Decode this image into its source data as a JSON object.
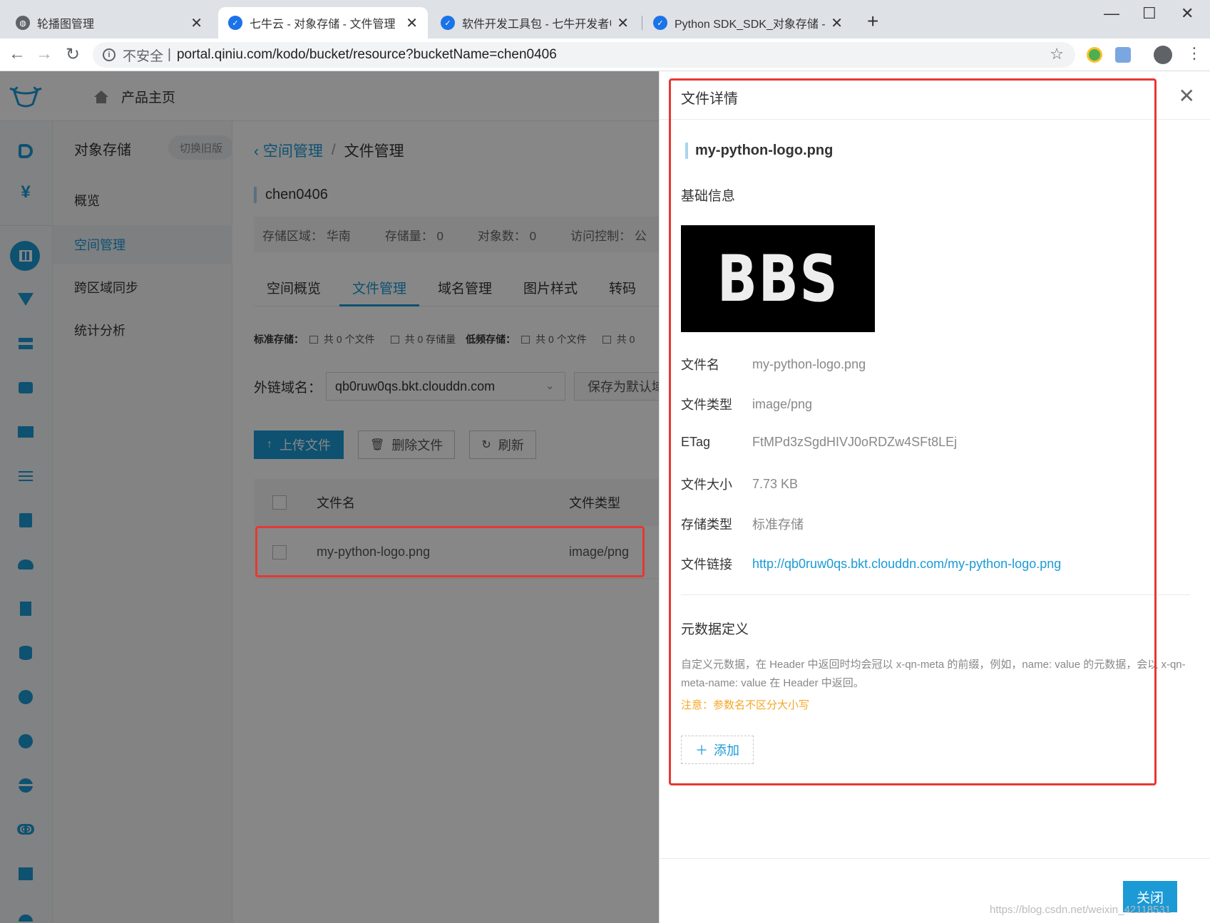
{
  "browser": {
    "tabs": [
      {
        "title": "轮播图管理",
        "close": "✕"
      },
      {
        "title": "七牛云 - 对象存储 - 文件管理",
        "close": "✕"
      },
      {
        "title": "软件开发工具包 - 七牛开发者中心",
        "close": "✕"
      },
      {
        "title": "Python SDK_SDK_对象存储 - 七牛",
        "close": "✕"
      }
    ],
    "new_tab": "+",
    "insecure_label": "不安全",
    "url": "portal.qiniu.com/kodo/bucket/resource?bucketName=chen0406"
  },
  "header": {
    "home_label": "产品主页"
  },
  "submenu": {
    "title": "对象存储",
    "old_version": "切换旧版",
    "items": [
      "概览",
      "空间管理",
      "跨区域同步",
      "统计分析"
    ]
  },
  "main": {
    "breadcrumb_back": "空间管理",
    "breadcrumb_sep": "/",
    "breadcrumb_current": "文件管理",
    "bucket": "chen0406",
    "stats": [
      "存储区域： 华南",
      "存储量： 0",
      "对象数： 0",
      "访问控制： 公"
    ],
    "tabs": [
      "空间概览",
      "文件管理",
      "域名管理",
      "图片样式",
      "转码"
    ],
    "storage": {
      "standard_label": "标准存储：",
      "standard_files": "共 0 个文件",
      "standard_size": "共 0 存储量",
      "low_label": "低频存储：",
      "low_files": "共 0 个文件",
      "low_size": "共 0"
    },
    "domain_label": "外链域名：",
    "domain_value": "qb0ruw0qs.bkt.clouddn.com",
    "save_default": "保存为默认域名",
    "upload": "上传文件",
    "delete": "删除文件",
    "refresh": "刷新",
    "table": {
      "headers": [
        "文件名",
        "文件类型"
      ],
      "rows": [
        {
          "name": "my-python-logo.png",
          "type": "image/png"
        }
      ]
    }
  },
  "drawer": {
    "title": "文件详情",
    "file_name": "my-python-logo.png",
    "basic_info": "基础信息",
    "preview_text": "BBS",
    "fields": [
      {
        "label": "文件名",
        "value": "my-python-logo.png"
      },
      {
        "label": "文件类型",
        "value": "image/png"
      },
      {
        "label": "ETag",
        "value": "FtMPd3zSgdHIVJ0oRDZw4SFt8LEj"
      },
      {
        "label": "文件大小",
        "value": "7.73 KB"
      },
      {
        "label": "存储类型",
        "value": "标准存储"
      },
      {
        "label": "文件链接",
        "value": "http://qb0ruw0qs.bkt.clouddn.com/my-python-logo.png"
      }
    ],
    "metadata_title": "元数据定义",
    "metadata_desc": "自定义元数据，在 Header 中返回时均会冠以 x-qn-meta 的前缀，例如，name: value 的元数据，会以 x-qn-meta-name: value 在 Header 中返回。",
    "metadata_warn": "注意：参数名不区分大小写",
    "add": "添加",
    "close": "关闭"
  },
  "watermark": "https://blog.csdn.net/weixin_42118531",
  "colors": {
    "accent": "#1b9ad6",
    "highlight_box": "#e53935",
    "warning": "#f5a623"
  }
}
